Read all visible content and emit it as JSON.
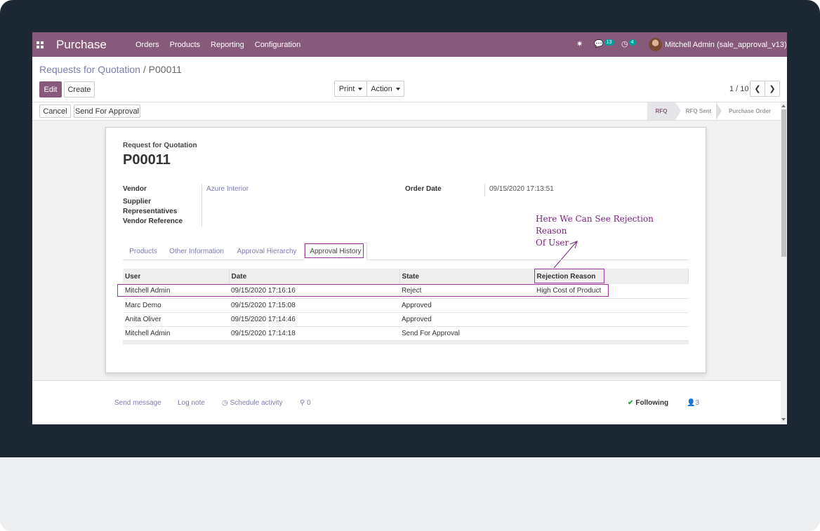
{
  "app": {
    "title": "Purchase"
  },
  "navbar": {
    "menu": [
      "Orders",
      "Products",
      "Reporting",
      "Configuration"
    ],
    "messages_count": "13",
    "activities_count": "4",
    "user": "Mitchell Admin (sale_approval_v13)"
  },
  "breadcrumb": {
    "parent": "Requests for Quotation",
    "separator": "/",
    "current": "P00011"
  },
  "toolbar": {
    "edit": "Edit",
    "create": "Create",
    "print": "Print",
    "action": "Action"
  },
  "pager": {
    "value": "1 / 10"
  },
  "statusbar": {
    "cancel": "Cancel",
    "send_for_approval": "Send For Approval",
    "stages": [
      "RFQ",
      "RFQ Sent",
      "Purchase Order"
    ],
    "active_stage": "RFQ"
  },
  "form": {
    "subtitle": "Request for Quotation",
    "name": "P00011",
    "vendor_label": "Vendor",
    "vendor_value": "Azure Interior",
    "supplier_rep_label_1": "Supplier",
    "supplier_rep_label_2": "Representatives",
    "vendor_ref_label": "Vendor Reference",
    "order_date_label": "Order Date",
    "order_date_value": "09/15/2020 17:13:51"
  },
  "tabs": [
    "Products",
    "Other Information",
    "Approval Hierarchy",
    "Approval History"
  ],
  "active_tab": "Approval History",
  "history": {
    "columns": [
      "User",
      "Date",
      "State",
      "Rejection Reason"
    ],
    "rows": [
      [
        "Mitchell Admin",
        "09/15/2020 17:16:16",
        "Reject",
        "High Cost of Product"
      ],
      [
        "Marc Demo",
        "09/15/2020 17:15:08",
        "Approved",
        ""
      ],
      [
        "Anita Oliver",
        "09/15/2020 17:14:46",
        "Approved",
        ""
      ],
      [
        "Mitchell Admin",
        "09/15/2020 17:14:18",
        "Send For Approval",
        ""
      ]
    ]
  },
  "annotation": {
    "line1": "Here We Can See Rejection Reason",
    "line2": "Of User"
  },
  "chatter": {
    "send_message": "Send message",
    "log_note": "Log note",
    "schedule_activity": "Schedule activity",
    "attachments": "0",
    "following": "Following",
    "followers": "3"
  },
  "colors": {
    "brand": "#875a7b",
    "link": "#7c7bad",
    "highlight": "#a0359b"
  },
  "icons": [
    "apps-grid-icon",
    "bug-icon",
    "chat-icon",
    "clock-icon",
    "caret-down-icon",
    "chevron-left-icon",
    "chevron-right-icon",
    "clock-outline-icon",
    "paperclip-icon",
    "check-icon",
    "user-icon"
  ]
}
